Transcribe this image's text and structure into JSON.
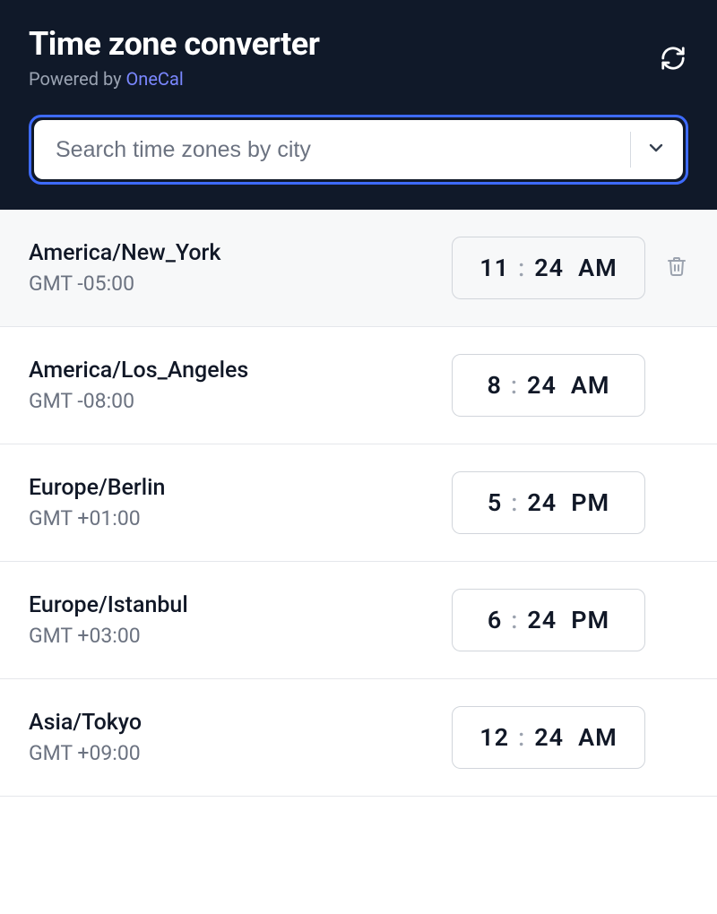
{
  "header": {
    "title": "Time zone converter",
    "subtitle_prefix": "Powered by ",
    "subtitle_link": "OneCal"
  },
  "search": {
    "placeholder": "Search time zones by city",
    "value": ""
  },
  "timezones": [
    {
      "name": "America/New_York",
      "offset": "GMT -05:00",
      "hour": "11",
      "minute": "24",
      "ampm": "AM",
      "current": true
    },
    {
      "name": "America/Los_Angeles",
      "offset": "GMT -08:00",
      "hour": "8",
      "minute": "24",
      "ampm": "AM",
      "current": false
    },
    {
      "name": "Europe/Berlin",
      "offset": "GMT +01:00",
      "hour": "5",
      "minute": "24",
      "ampm": "PM",
      "current": false
    },
    {
      "name": "Europe/Istanbul",
      "offset": "GMT +03:00",
      "hour": "6",
      "minute": "24",
      "ampm": "PM",
      "current": false
    },
    {
      "name": "Asia/Tokyo",
      "offset": "GMT +09:00",
      "hour": "12",
      "minute": "24",
      "ampm": "AM",
      "current": false
    }
  ]
}
